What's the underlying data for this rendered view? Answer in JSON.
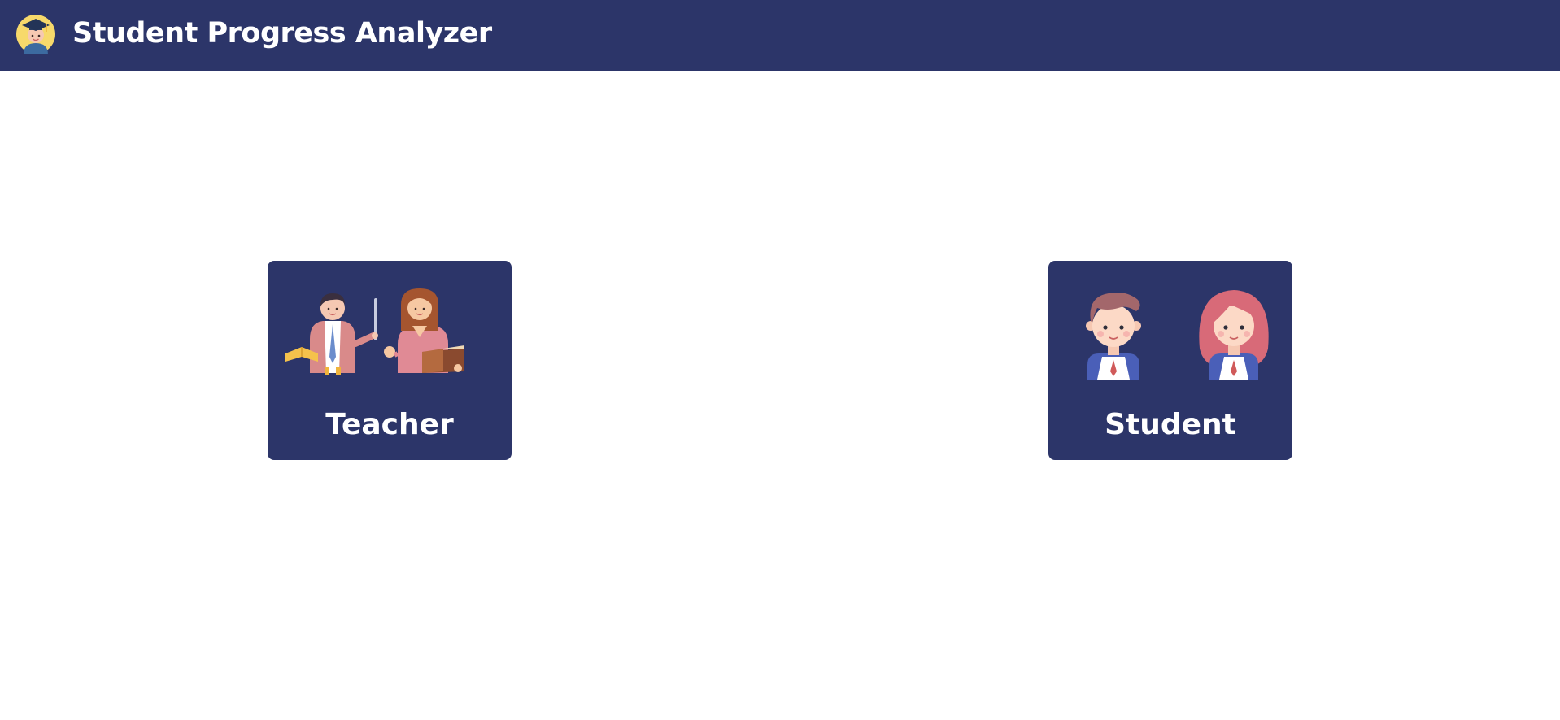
{
  "header": {
    "title": "Student Progress Analyzer",
    "logo_icon": "graduate-avatar-icon"
  },
  "roles": [
    {
      "label": "Teacher",
      "icon": "teachers-illustration-icon"
    },
    {
      "label": "Student",
      "icon": "students-illustration-icon"
    }
  ],
  "colors": {
    "brand": "#2c3569",
    "background": "#ffffff",
    "text_on_brand": "#ffffff"
  }
}
